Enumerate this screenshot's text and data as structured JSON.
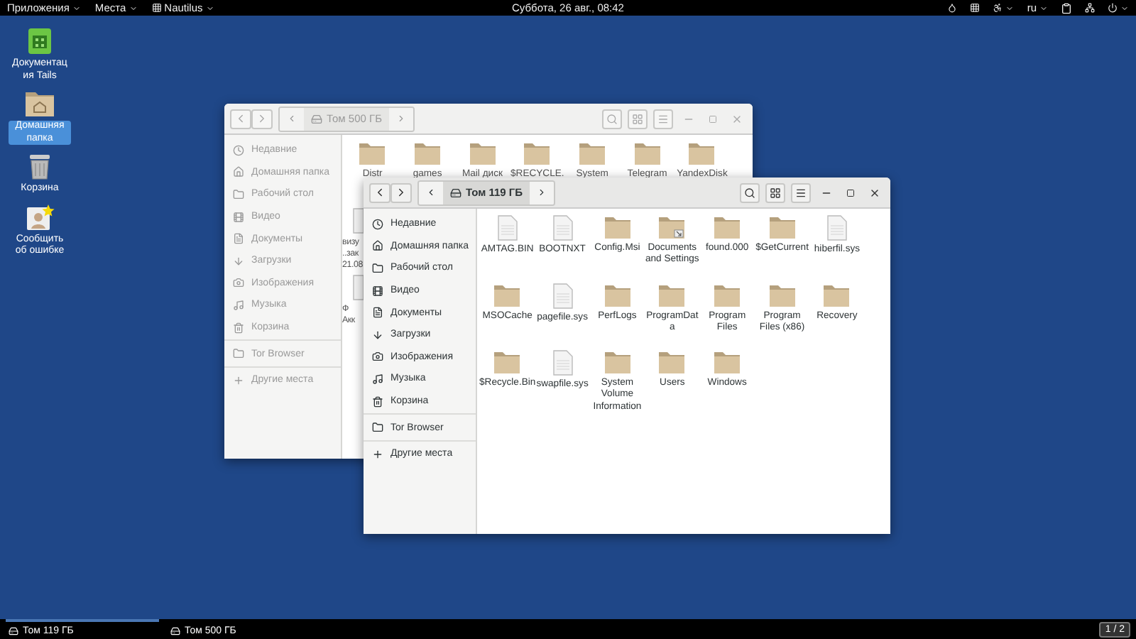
{
  "top_bar": {
    "menus": [
      "Приложения",
      "Места",
      "Nautilus"
    ],
    "clock": "Суббота, 26 авг., 08:42",
    "keyboard_layout": "ru"
  },
  "desktop_icons": [
    {
      "label": "Документация Tails",
      "kind": "doc",
      "selected": false
    },
    {
      "label": "Домашняя папка",
      "kind": "home",
      "selected": true
    },
    {
      "label": "Корзина",
      "kind": "trash",
      "selected": false
    },
    {
      "label": "Сообщить об ошибке",
      "kind": "report",
      "selected": false
    }
  ],
  "windows": [
    {
      "path": "Том 500 ГБ",
      "active": false,
      "sidebar": [
        [
          "Недавние",
          "Домашняя папка",
          "Рабочий стол",
          "Видео",
          "Документы",
          "Загрузки",
          "Изображения",
          "Музыка",
          "Корзина"
        ],
        [
          "Tor Browser"
        ],
        [
          "Другие места"
        ]
      ],
      "files": [
        {
          "label": "Distr",
          "kind": "folder"
        },
        {
          "label": "games",
          "kind": "folder"
        },
        {
          "label": "Mail диск",
          "kind": "folder"
        },
        {
          "label": "$RECYCLE.",
          "kind": "folder"
        },
        {
          "label": "System",
          "kind": "folder"
        },
        {
          "label": "Telegram",
          "kind": "folder"
        },
        {
          "label": "YandexDisk",
          "kind": "folder"
        }
      ],
      "partial_files": [
        {
          "lines": [
            "визу",
            "..зак",
            "21.08"
          ]
        },
        {
          "lines": [
            "Ф",
            "Акк"
          ]
        }
      ]
    },
    {
      "path": "Том 119 ГБ",
      "active": true,
      "sidebar": [
        [
          "Недавние",
          "Домашняя папка",
          "Рабочий стол",
          "Видео",
          "Документы",
          "Загрузки",
          "Изображения",
          "Музыка",
          "Корзина"
        ],
        [
          "Tor Browser"
        ],
        [
          "Другие места"
        ]
      ],
      "files": [
        {
          "label": "AMTAG.BIN",
          "kind": "file"
        },
        {
          "label": "BOOTNXT",
          "kind": "file"
        },
        {
          "label": "Config.Msi",
          "kind": "folder"
        },
        {
          "label": "Documents and Settings",
          "kind": "link-folder"
        },
        {
          "label": "found.000",
          "kind": "folder"
        },
        {
          "label": "$GetCurrent",
          "kind": "folder"
        },
        {
          "label": "hiberfil.sys",
          "kind": "file"
        },
        {
          "label": "MSOCache",
          "kind": "folder"
        },
        {
          "label": "pagefile.sys",
          "kind": "file"
        },
        {
          "label": "PerfLogs",
          "kind": "folder"
        },
        {
          "label": "ProgramData",
          "kind": "folder"
        },
        {
          "label": "Program Files",
          "kind": "folder"
        },
        {
          "label": "Program Files (x86)",
          "kind": "folder"
        },
        {
          "label": "Recovery",
          "kind": "folder"
        },
        {
          "label": "$Recycle.Bin",
          "kind": "folder"
        },
        {
          "label": "swapfile.sys",
          "kind": "file"
        },
        {
          "label": "System Volume Information",
          "kind": "folder"
        },
        {
          "label": "Users",
          "kind": "folder"
        },
        {
          "label": "Windows",
          "kind": "folder"
        }
      ]
    }
  ],
  "taskbar": {
    "tasks": [
      {
        "label": "Том 119 ГБ",
        "selected": true
      },
      {
        "label": "Том 500 ГБ",
        "selected": false
      }
    ],
    "workspace": "1 / 2"
  }
}
